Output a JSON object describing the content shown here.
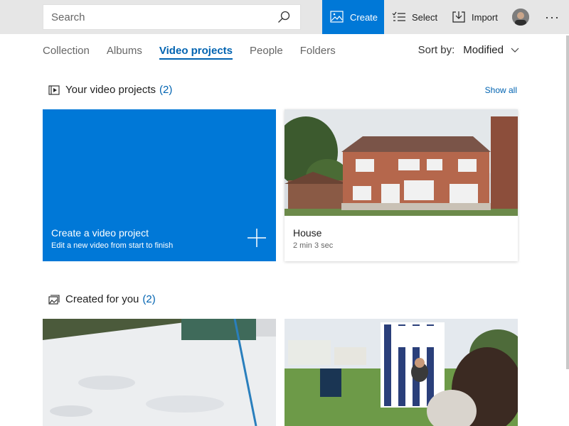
{
  "search": {
    "placeholder": "Search"
  },
  "toolbar": {
    "create_label": "Create",
    "select_label": "Select",
    "import_label": "Import",
    "more_label": "···"
  },
  "nav": {
    "tabs": [
      {
        "label": "Collection"
      },
      {
        "label": "Albums"
      },
      {
        "label": "Video projects",
        "active": true
      },
      {
        "label": "People"
      },
      {
        "label": "Folders"
      }
    ]
  },
  "sort": {
    "label": "Sort by:",
    "value": "Modified"
  },
  "sections": {
    "video_projects": {
      "title": "Your video projects",
      "count": "(2)",
      "show_all": "Show all"
    },
    "created_for_you": {
      "title": "Created for you",
      "count": "(2)"
    }
  },
  "cards": {
    "create": {
      "title": "Create a video project",
      "subtitle": "Edit a new video from start to finish"
    },
    "house": {
      "title": "House",
      "duration": "2 min 3 sec"
    }
  },
  "colors": {
    "accent": "#0078d7",
    "link": "#0063b1",
    "topbar": "#e6e6e6"
  }
}
